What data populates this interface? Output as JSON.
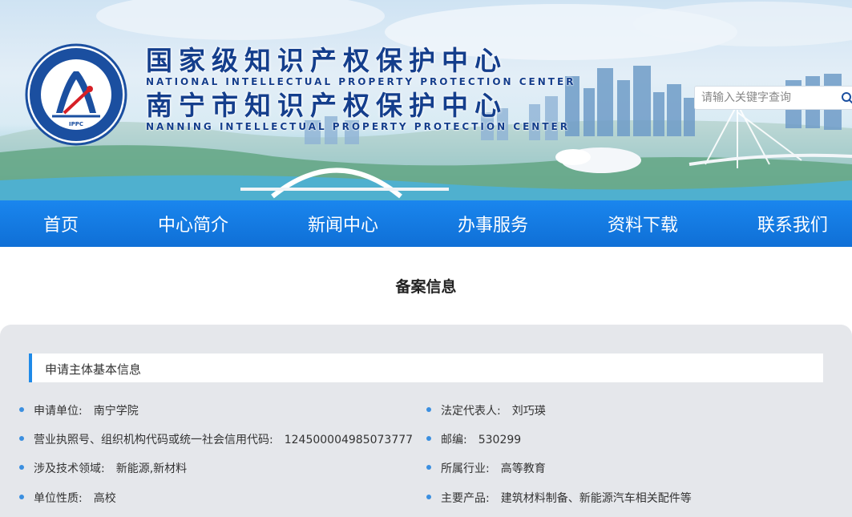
{
  "header": {
    "logo": {
      "ring_text": "南宁市知识产权保护中心",
      "ring_text_en": "Nanning Intellectual Property Protection Center",
      "abbr": "IPPC"
    },
    "title_cn_1": "国家级知识产权保护中心",
    "title_en_1": "NATIONAL INTELLECTUAL PROPERTY PROTECTION CENTER",
    "title_cn_2": "南宁市知识产权保护中心",
    "title_en_2": "NANNING INTELLECTUAL PROPERTY PROTECTION CENTER",
    "search": {
      "placeholder": "请输入关键字查询",
      "icon": "search-icon"
    }
  },
  "nav": {
    "items": [
      {
        "label": "首页"
      },
      {
        "label": "中心简介"
      },
      {
        "label": "新闻中心"
      },
      {
        "label": "办事服务"
      },
      {
        "label": "资料下载"
      },
      {
        "label": "联系我们"
      }
    ]
  },
  "main": {
    "title": "备案信息",
    "section_title": "申请主体基本信息",
    "fields_left": [
      {
        "label": "申请单位:",
        "value": "南宁学院"
      },
      {
        "label": "营业执照号、组织机构代码或统一社会信用代码:",
        "value": "124500004985073777"
      },
      {
        "label": "涉及技术领域:",
        "value": "新能源,新材料"
      },
      {
        "label": "单位性质:",
        "value": "高校"
      }
    ],
    "fields_right": [
      {
        "label": "法定代表人:",
        "value": "刘巧瑛"
      },
      {
        "label": "邮编:",
        "value": "530299"
      },
      {
        "label": "所属行业:",
        "value": "高等教育"
      },
      {
        "label": "主要产品:",
        "value": "建筑材料制备、新能源汽车相关配件等"
      }
    ]
  },
  "colors": {
    "primary": "#1a86ee",
    "title_blue": "#143e8c",
    "accent_bar": "#1f8ae8",
    "panel_bg": "#e5e7eb"
  }
}
